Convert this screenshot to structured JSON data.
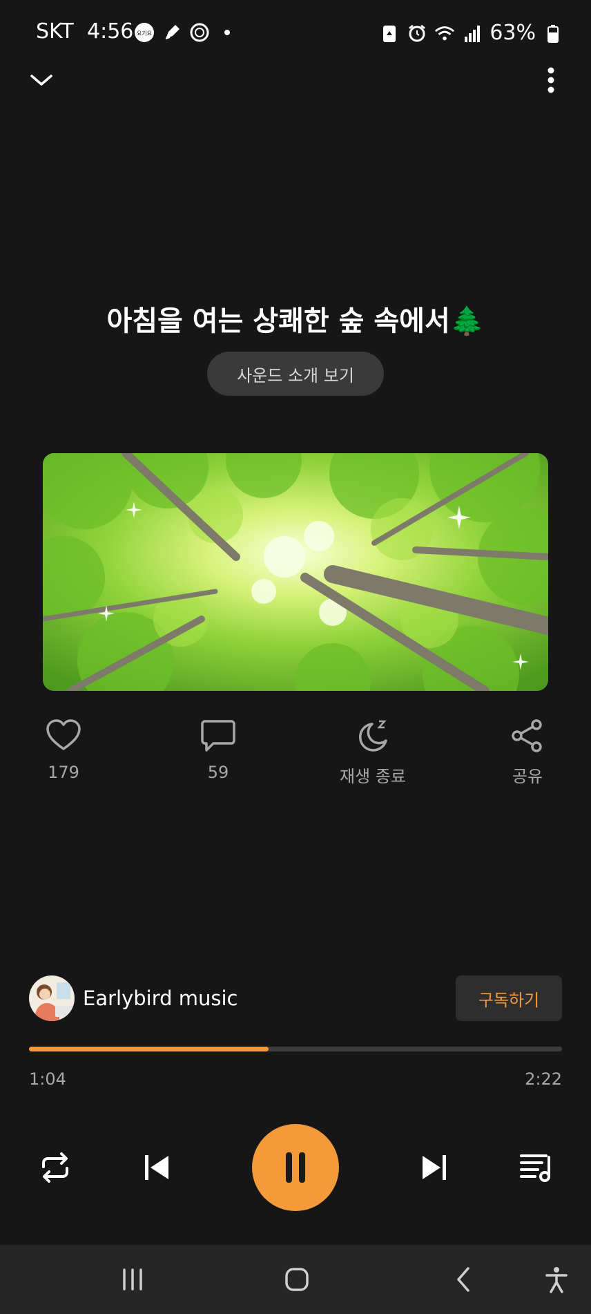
{
  "status_bar": {
    "carrier": "SKT",
    "time": "4:56",
    "battery": "63%",
    "left_icons": [
      "yogiyo-icon",
      "pen-icon",
      "ring-icon",
      "dot-icon"
    ],
    "right_icons": [
      "recycle-icon",
      "alarm-icon",
      "wifi-icon",
      "signal-icon",
      "battery-icon"
    ]
  },
  "header": {
    "collapse_icon": "chevron-down-icon",
    "more_icon": "more-vertical-icon"
  },
  "track": {
    "title": "아침을 여는 상쾌한 숲 속에서🌲",
    "intro_button": "사운드 소개 보기"
  },
  "actions": {
    "likes": "179",
    "comments": "59",
    "sleep_label": "재생 종료",
    "share_label": "공유"
  },
  "channel": {
    "name": "Earlybird music",
    "subscribe_label": "구독하기"
  },
  "playback": {
    "current_time": "1:04",
    "total_time": "2:22",
    "progress_fraction": 0.45,
    "state": "playing"
  },
  "colors": {
    "background": "#161616",
    "accent": "#f39a3b",
    "muted_text": "#a8a8a8",
    "button_bg": "#3a3a3a",
    "navbar_bg": "#262626"
  },
  "controls": [
    "repeat-icon",
    "previous-icon",
    "pause-icon",
    "next-icon",
    "playlist-icon"
  ],
  "nav_bar": [
    "recent-apps-icon",
    "home-icon",
    "back-icon",
    "accessibility-icon"
  ]
}
